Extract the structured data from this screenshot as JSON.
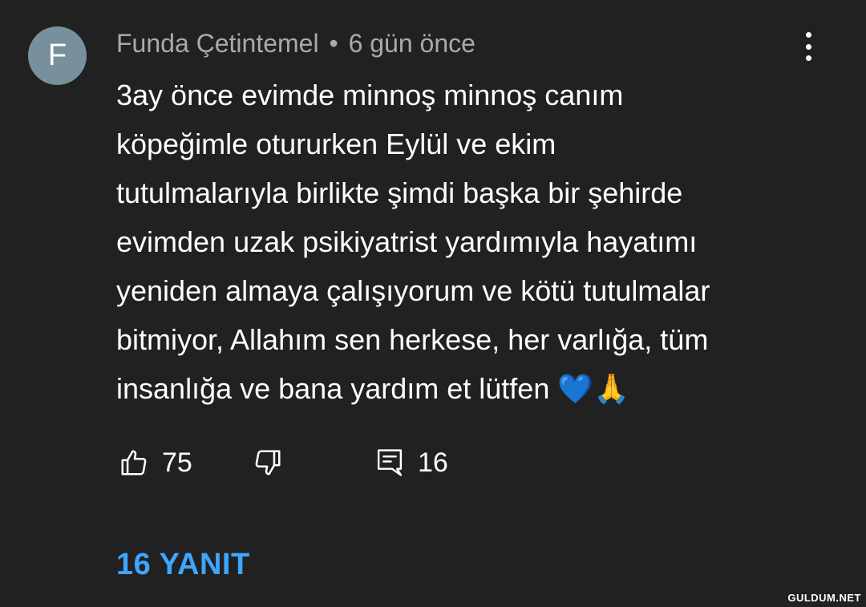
{
  "comment": {
    "avatar_letter": "F",
    "author": "Funda Çetintemel",
    "separator": "•",
    "time": "6 gün önce",
    "text_lines": [
      "3ay önce evimde minnoş minnoş canım",
      "köpeğimle otururken Eylül ve ekim",
      "tutulmalarıyla birlikte şimdi başka bir şehirde",
      "evimden uzak psikiyatrist yardımıyla hayatımı",
      "yeniden almaya çalışıyorum ve kötü tutulmalar",
      "bitmiyor, Allahım sen herkese, her varlığa, tüm",
      "insanlığa ve bana yardım et lütfen 💙🙏"
    ],
    "like_count": "75",
    "reply_count": "16",
    "replies_label": "16 YANIT"
  },
  "watermark": "GULDUM.NET",
  "colors": {
    "background": "#212121",
    "avatar": "#78909c",
    "meta_text": "#aaaaaa",
    "link": "#3ea6ff"
  },
  "icons": [
    "more-vert-icon",
    "thumb-up-icon",
    "thumb-down-icon",
    "comment-icon"
  ]
}
